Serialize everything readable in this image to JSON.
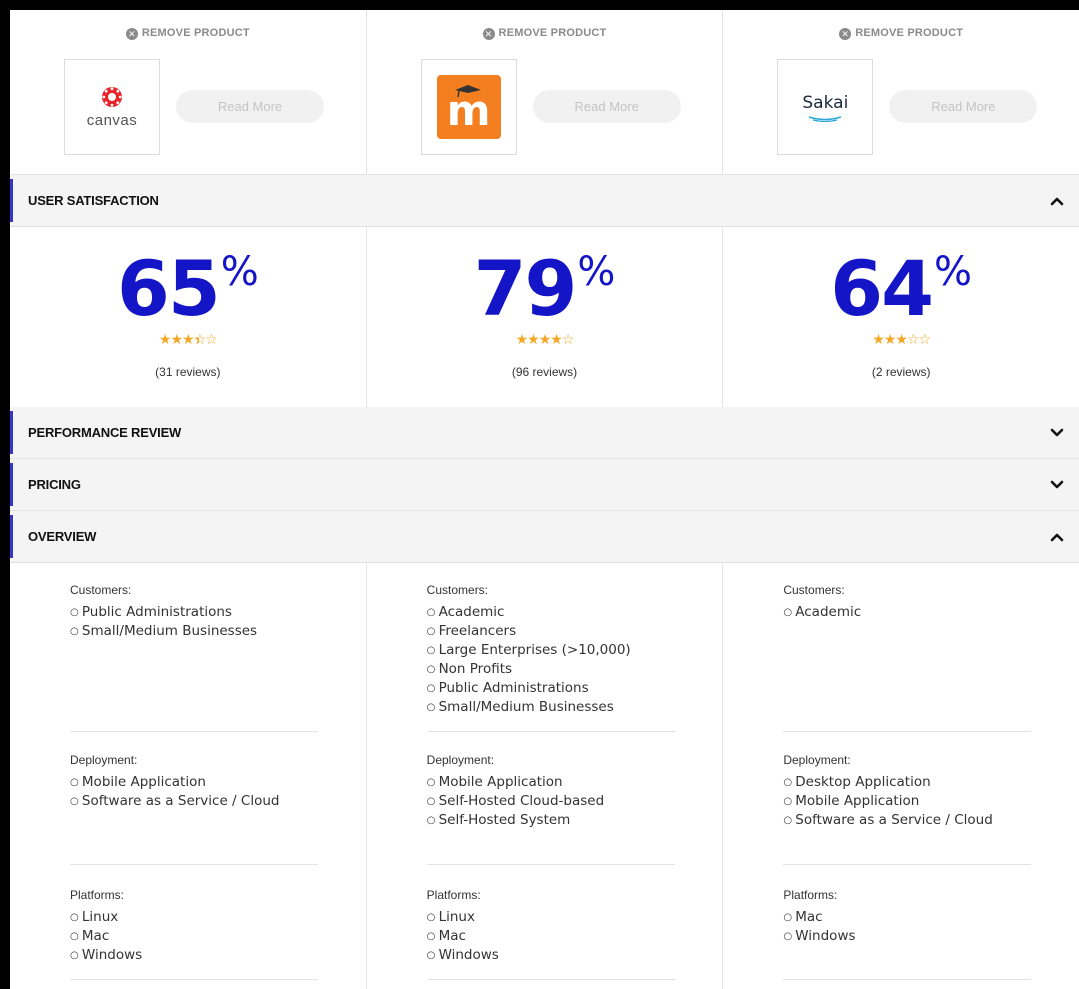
{
  "products": [
    {
      "remove_label": "REMOVE PRODUCT",
      "logo": "canvas-logo",
      "logo_text": "canvas",
      "read_more": "Read More"
    },
    {
      "remove_label": "REMOVE PRODUCT",
      "logo": "moodle-logo",
      "logo_text": "m",
      "read_more": "Read More"
    },
    {
      "remove_label": "REMOVE PRODUCT",
      "logo": "sakai-logo",
      "logo_text": "Sakai",
      "read_more": "Read More"
    }
  ],
  "sections": {
    "user_satisfaction": {
      "title": "USER SATISFACTION",
      "state": "expanded"
    },
    "performance_review": {
      "title": "PERFORMANCE REVIEW",
      "state": "collapsed"
    },
    "pricing": {
      "title": "PRICING",
      "state": "collapsed"
    },
    "overview": {
      "title": "OVERVIEW",
      "state": "expanded"
    }
  },
  "satisfaction": [
    {
      "percent": "65",
      "sign": "%",
      "rating": 3.5,
      "reviews": "(31 reviews)"
    },
    {
      "percent": "79",
      "sign": "%",
      "rating": 4,
      "reviews": "(96 reviews)"
    },
    {
      "percent": "64",
      "sign": "%",
      "rating": 3,
      "reviews": "(2 reviews)"
    }
  ],
  "overview": [
    {
      "customers_label": "Customers:",
      "customers": [
        "Public Administrations",
        "Small/Medium Businesses"
      ],
      "deployment_label": "Deployment:",
      "deployment": [
        "Mobile Application",
        "Software as a Service / Cloud"
      ],
      "platforms_label": "Platforms:",
      "platforms": [
        "Linux",
        "Mac",
        "Windows"
      ]
    },
    {
      "customers_label": "Customers:",
      "customers": [
        "Academic",
        "Freelancers",
        "Large Enterprises (>10,000)",
        "Non Profits",
        "Public Administrations",
        "Small/Medium Businesses"
      ],
      "deployment_label": "Deployment:",
      "deployment": [
        "Mobile Application",
        "Self-Hosted Cloud-based",
        "Self-Hosted System"
      ],
      "platforms_label": "Platforms:",
      "platforms": [
        "Linux",
        "Mac",
        "Windows"
      ]
    },
    {
      "customers_label": "Customers:",
      "customers": [
        "Academic"
      ],
      "deployment_label": "Deployment:",
      "deployment": [
        "Desktop Application",
        "Mobile Application",
        "Software as a Service / Cloud"
      ],
      "platforms_label": "Platforms:",
      "platforms": [
        "Mac",
        "Windows"
      ]
    }
  ],
  "colors": {
    "accent": "#1515c8",
    "section_marker": "#3636c8",
    "star": "#f5a623",
    "moodle_orange": "#f47f20"
  }
}
